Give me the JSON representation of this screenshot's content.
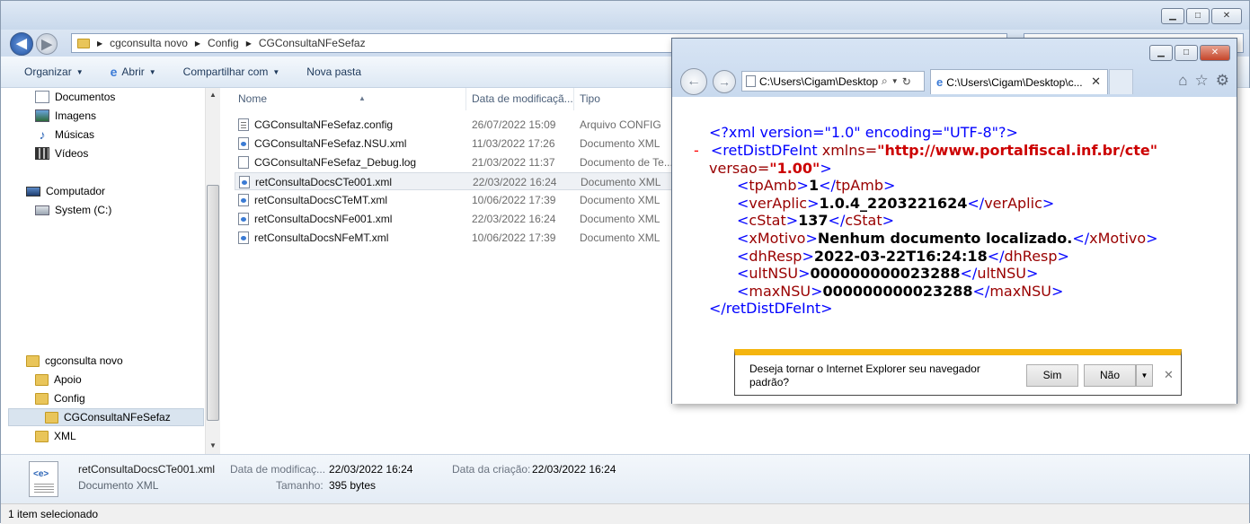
{
  "explorer": {
    "breadcrumb": [
      "cgconsulta novo",
      "Config",
      "CGConsultaNFeSefaz"
    ],
    "toolbar": {
      "organizar": "Organizar",
      "abrir": "Abrir",
      "compartilhar": "Compartilhar com",
      "nova_pasta": "Nova pasta"
    },
    "nav": {
      "libraries": [
        "Documentos",
        "Imagens",
        "Músicas",
        "Vídeos"
      ],
      "computador": "Computador",
      "system": "System (C:)",
      "root_folder": "cgconsulta novo",
      "subfolders": [
        "Apoio",
        "Config",
        "CGConsultaNFeSefaz",
        "XML"
      ]
    },
    "columns": {
      "name": "Nome",
      "date": "Data de modificaçã...",
      "type": "Tipo"
    },
    "files": [
      {
        "name": "CGConsultaNFeSefaz.config",
        "date": "26/07/2022 15:09",
        "type": "Arquivo CONFIG",
        "icon": "config-file"
      },
      {
        "name": "CGConsultaNFeSefaz.NSU.xml",
        "date": "11/03/2022 17:26",
        "type": "Documento XML",
        "icon": "xml-file"
      },
      {
        "name": "CGConsultaNFeSefaz_Debug.log",
        "date": "21/03/2022 11:37",
        "type": "Documento de Te...",
        "icon": "text-file"
      },
      {
        "name": "retConsultaDocsCTe001.xml",
        "date": "22/03/2022 16:24",
        "type": "Documento XML",
        "icon": "xml-file"
      },
      {
        "name": "retConsultaDocsCTeMT.xml",
        "date": "10/06/2022 17:39",
        "type": "Documento XML",
        "icon": "xml-file"
      },
      {
        "name": "retConsultaDocsNFe001.xml",
        "date": "22/03/2022 16:24",
        "type": "Documento XML",
        "icon": "xml-file"
      },
      {
        "name": "retConsultaDocsNFeMT.xml",
        "date": "10/06/2022 17:39",
        "type": "Documento XML",
        "icon": "xml-file"
      }
    ],
    "details": {
      "name": "retConsultaDocsCTe001.xml",
      "type": "Documento XML",
      "mod_label": "Data de modificaç...",
      "mod_value": "22/03/2022 16:24",
      "size_label": "Tamanho:",
      "size_value": "395 bytes",
      "created_label": "Data da criação:",
      "created_value": "22/03/2022 16:24"
    },
    "status": "1 item selecionado"
  },
  "ie": {
    "url": "C:\\Users\\Cigam\\Desktop",
    "tab_title": "C:\\Users\\Cigam\\Desktop\\c...",
    "xml": {
      "decl": "<?xml version=\"1.0\" encoding=\"UTF-8\"?>",
      "minus": "-",
      "root_open_tag": "<retDistDFeInt",
      "xmlns_attr": "xmlns=",
      "xmlns_val": "\"http://www.portalfiscal.inf.br/cte\"",
      "versao_attr": "versao=",
      "versao_val": "\"1.00\"",
      "gt": ">",
      "elements": [
        {
          "name": "tpAmb",
          "value": "1"
        },
        {
          "name": "verAplic",
          "value": "1.0.4_2203221624"
        },
        {
          "name": "cStat",
          "value": "137"
        },
        {
          "name": "xMotivo",
          "value": "Nenhum documento localizado."
        },
        {
          "name": "dhResp",
          "value": "2022-03-22T16:24:18"
        },
        {
          "name": "ultNSU",
          "value": "000000000023288"
        },
        {
          "name": "maxNSU",
          "value": "000000000023288"
        }
      ],
      "root_close": "</retDistDFeInt>"
    },
    "notification": {
      "text": "Deseja tornar o Internet Explorer seu navegador padrão?",
      "yes": "Sim",
      "no": "Não"
    }
  },
  "colors": {
    "accent": "#f5b50f",
    "xml_tag": "#0000ff",
    "xml_name": "#990000"
  }
}
